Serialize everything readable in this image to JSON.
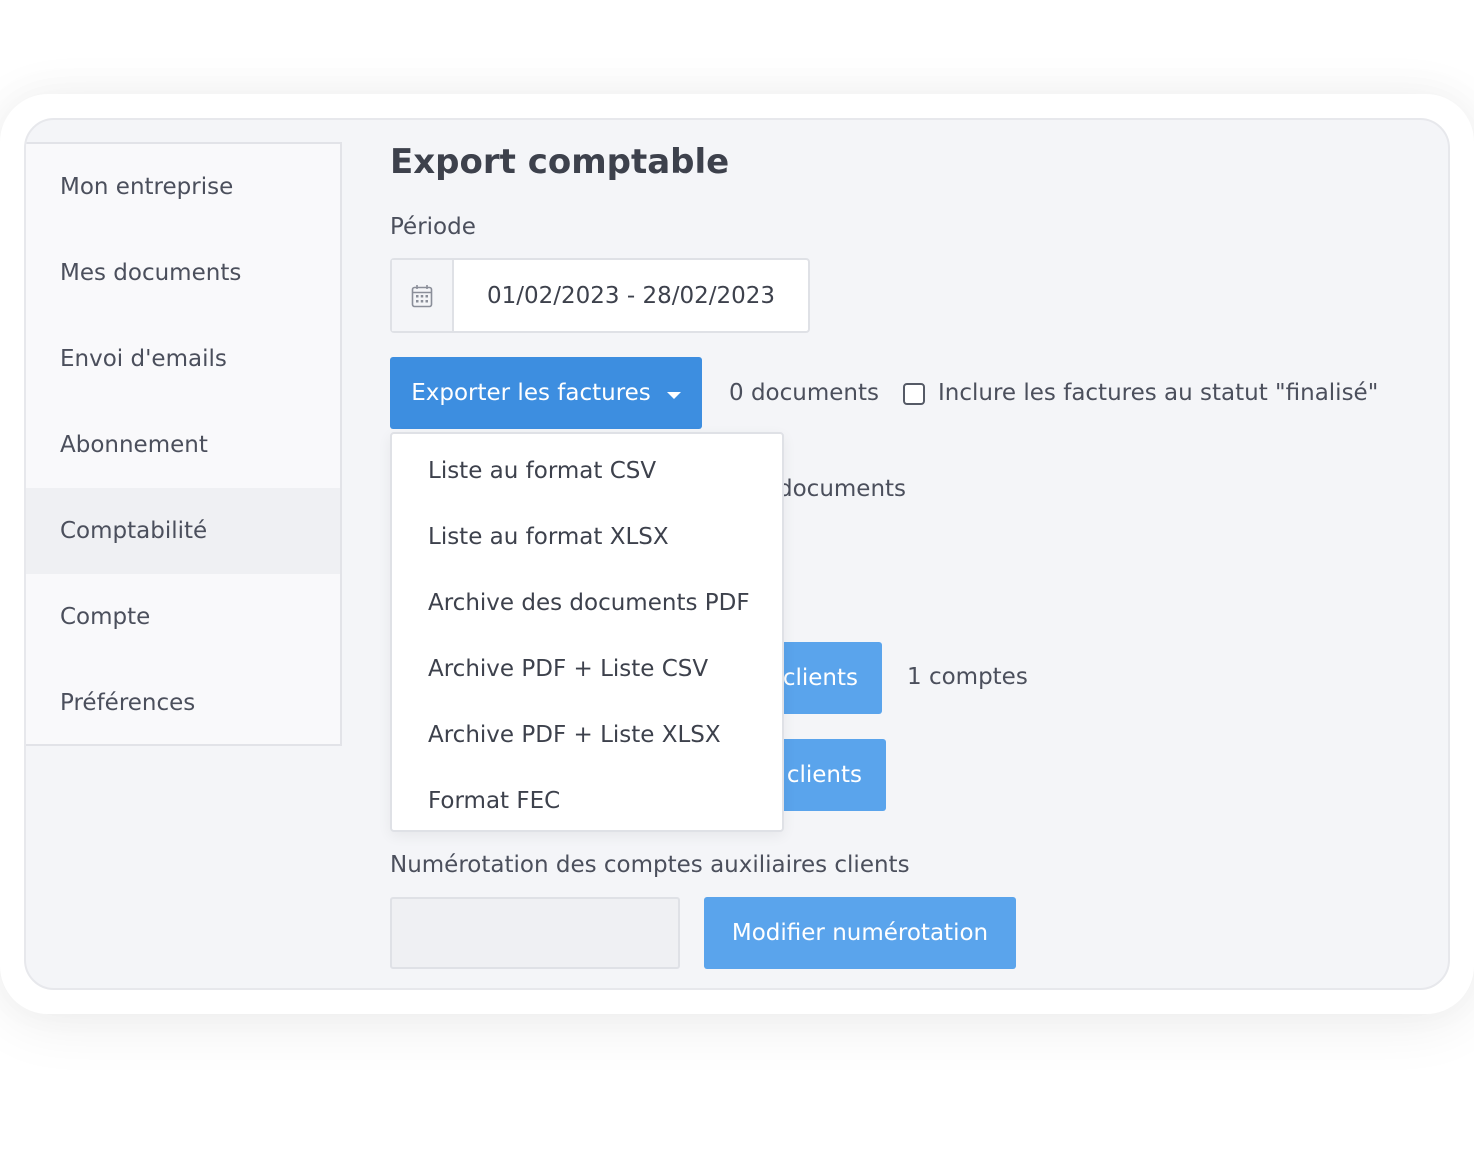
{
  "sidebar": {
    "items": [
      {
        "label": "Mon entreprise"
      },
      {
        "label": "Mes documents"
      },
      {
        "label": "Envoi d'emails"
      },
      {
        "label": "Abonnement"
      },
      {
        "label": "Comptabilité"
      },
      {
        "label": "Compte"
      },
      {
        "label": "Préférences"
      }
    ],
    "active": "Comptabilité"
  },
  "main": {
    "title": "Export comptable",
    "period_label": "Période",
    "period_value": "01/02/2023 - 28/02/2023",
    "calendar_icon": "calendar-icon",
    "export_invoices_label": "Exporter les factures",
    "documents_count": "0 documents",
    "include_finalized_label": "Inclure les factures au statut \"finalisé\"",
    "include_finalized_checked": false,
    "hidden_documents_count": "documents",
    "clients_button_1_partial": "clients",
    "accounts_count": "1 comptes",
    "clients_button_2_partial": "clients",
    "numbering_label": "Numérotation des comptes auxiliaires clients",
    "numbering_value": "",
    "modify_numbering_label": "Modifier numérotation"
  },
  "dropdown": {
    "items": [
      {
        "label": "Liste au format CSV"
      },
      {
        "label": "Liste au format XLSX"
      },
      {
        "label": "Archive des documents PDF"
      },
      {
        "label": "Archive PDF + Liste CSV"
      },
      {
        "label": "Archive PDF + Liste XLSX"
      },
      {
        "label": "Format FEC"
      }
    ]
  },
  "colors": {
    "primary": "#3d8ee0",
    "primary_light": "#5aa4ec",
    "background": "#f4f5f8",
    "text": "#4b4f5c"
  }
}
